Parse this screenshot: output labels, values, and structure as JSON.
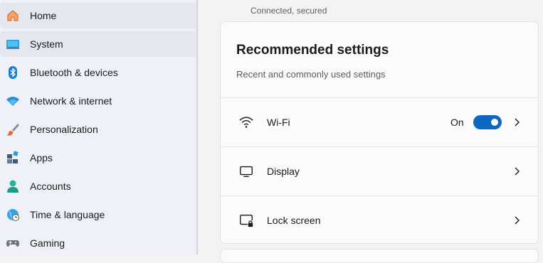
{
  "sidebar": {
    "items": [
      {
        "label": "Home",
        "icon": "home-icon"
      },
      {
        "label": "System",
        "icon": "system-icon"
      },
      {
        "label": "Bluetooth & devices",
        "icon": "bluetooth-icon"
      },
      {
        "label": "Network & internet",
        "icon": "network-icon"
      },
      {
        "label": "Personalization",
        "icon": "brush-icon"
      },
      {
        "label": "Apps",
        "icon": "apps-icon"
      },
      {
        "label": "Accounts",
        "icon": "accounts-icon"
      },
      {
        "label": "Time & language",
        "icon": "globe-icon"
      },
      {
        "label": "Gaming",
        "icon": "gamepad-icon"
      }
    ]
  },
  "header": {
    "connection_status": "Connected, secured"
  },
  "recommended": {
    "title": "Recommended settings",
    "subtitle": "Recent and commonly used settings",
    "rows": [
      {
        "label": "Wi-Fi",
        "icon": "wifi-icon",
        "toggle_label": "On",
        "toggle_state": true
      },
      {
        "label": "Display",
        "icon": "display-icon"
      },
      {
        "label": "Lock screen",
        "icon": "lock-screen-icon"
      }
    ]
  },
  "colors": {
    "accent": "#0f67c2",
    "sidebar_bg": "#eef1f7",
    "card_bg": "#fbfbfb"
  }
}
